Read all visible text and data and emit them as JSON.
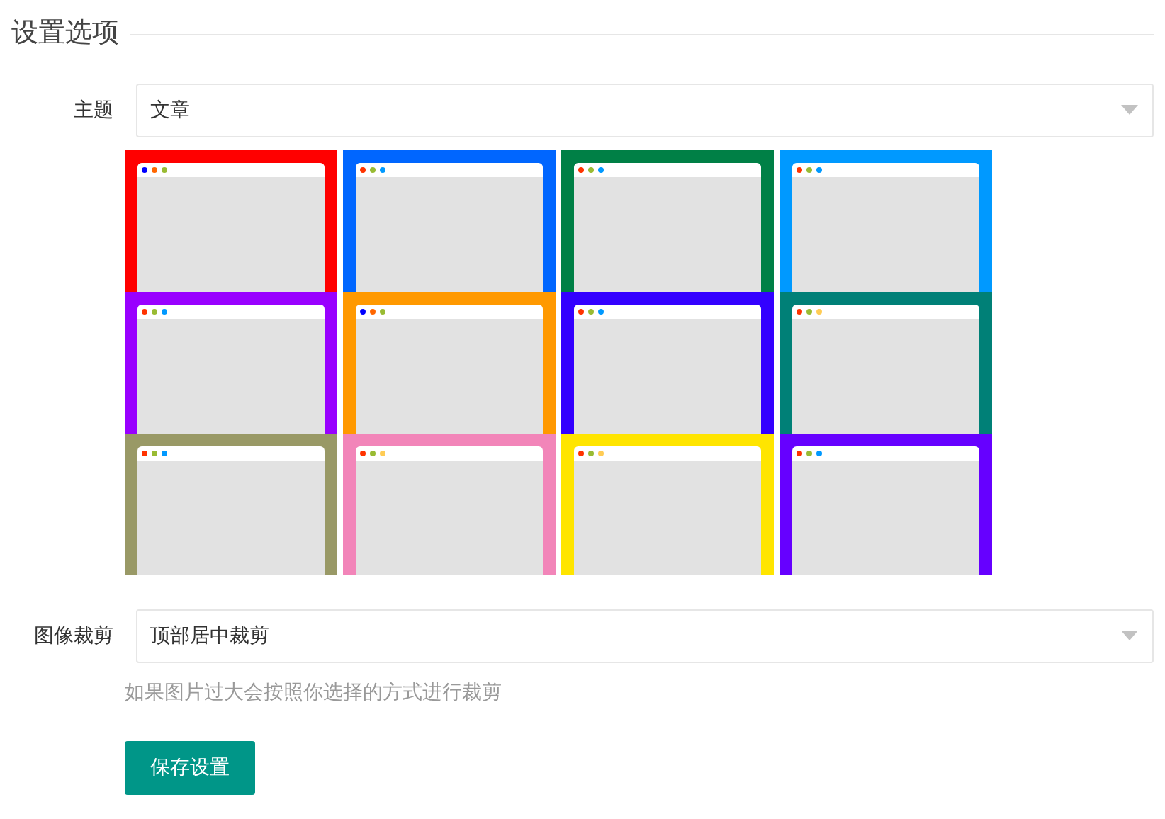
{
  "section_title": "设置选项",
  "theme_field": {
    "label": "主题",
    "value": "文章"
  },
  "themes": [
    {
      "color": "#ff0000",
      "dots": [
        {
          "color": "#0000ff"
        },
        {
          "color": "#ff6600"
        },
        {
          "color": "#99bb33"
        }
      ]
    },
    {
      "color": "#0066ff",
      "dots": [
        {
          "color": "#ff3300"
        },
        {
          "color": "#99bb33"
        },
        {
          "color": "#0099ff"
        }
      ]
    },
    {
      "color": "#008046",
      "dots": [
        {
          "color": "#ff3300"
        },
        {
          "color": "#99bb33"
        },
        {
          "color": "#0099ff"
        }
      ]
    },
    {
      "color": "#0099ff",
      "dots": [
        {
          "color": "#ff3300"
        },
        {
          "color": "#99bb33"
        },
        {
          "color": "#0099ff"
        }
      ]
    },
    {
      "color": "#9900ff",
      "dots": [
        {
          "color": "#ff3300"
        },
        {
          "color": "#99bb33"
        },
        {
          "color": "#0099ff"
        }
      ]
    },
    {
      "color": "#ff9900",
      "dots": [
        {
          "color": "#0000ff"
        },
        {
          "color": "#ff6600"
        },
        {
          "color": "#99bb33"
        }
      ]
    },
    {
      "color": "#3300ff",
      "dots": [
        {
          "color": "#ff3300"
        },
        {
          "color": "#99bb33"
        },
        {
          "color": "#0099ff"
        }
      ]
    },
    {
      "color": "#008077",
      "dots": [
        {
          "color": "#ff3300"
        },
        {
          "color": "#99bb33"
        },
        {
          "color": "#ffcc55"
        }
      ]
    },
    {
      "color": "#999966",
      "dots": [
        {
          "color": "#ff3300"
        },
        {
          "color": "#99bb33"
        },
        {
          "color": "#0099ff"
        }
      ]
    },
    {
      "color": "#f285b9",
      "dots": [
        {
          "color": "#ff3300"
        },
        {
          "color": "#99bb33"
        },
        {
          "color": "#ffcc55"
        }
      ]
    },
    {
      "color": "#ffe500",
      "dots": [
        {
          "color": "#ff3300"
        },
        {
          "color": "#99bb33"
        },
        {
          "color": "#ffcc55"
        }
      ]
    },
    {
      "color": "#6600ff",
      "dots": [
        {
          "color": "#ff3300"
        },
        {
          "color": "#99bb33"
        },
        {
          "color": "#0099ff"
        }
      ]
    }
  ],
  "crop_field": {
    "label": "图像裁剪",
    "value": "顶部居中裁剪",
    "hint": "如果图片过大会按照你选择的方式进行裁剪"
  },
  "save_button": "保存设置"
}
